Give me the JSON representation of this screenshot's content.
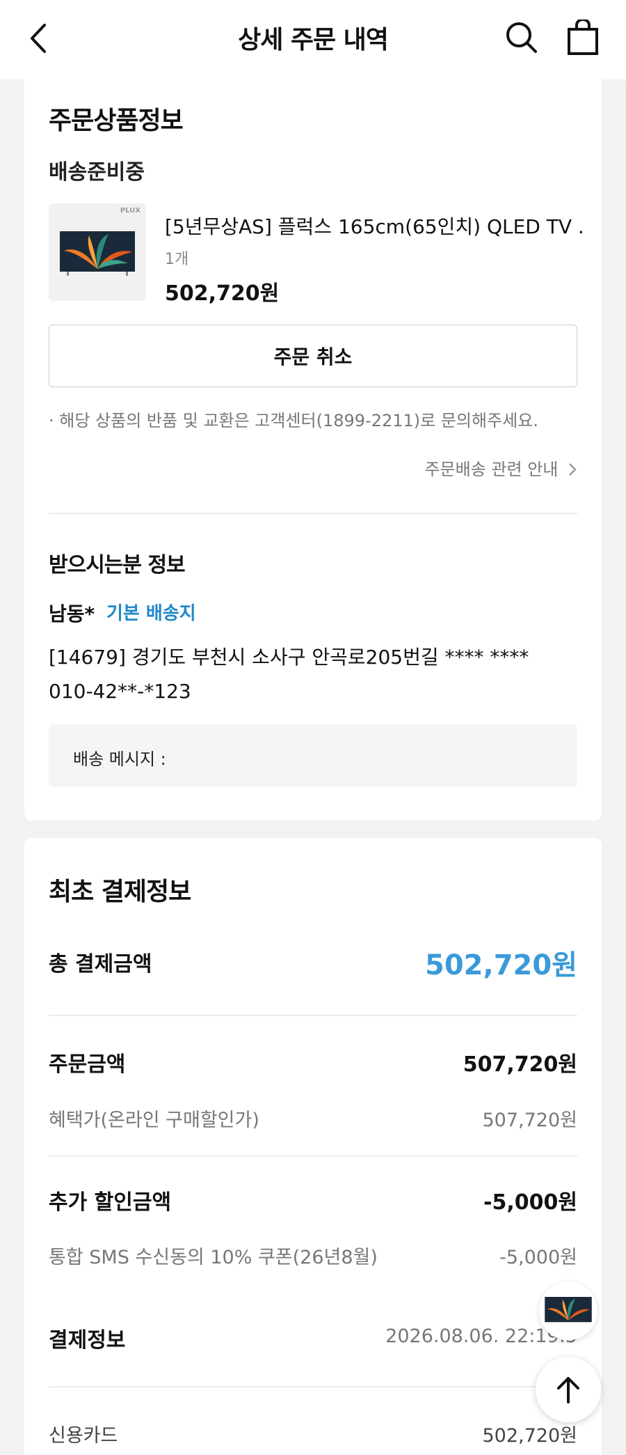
{
  "header": {
    "title": "상세 주문 내역"
  },
  "order_product": {
    "section_title": "주문상품정보",
    "status": "배송준비중",
    "thumb_brand": "PLUX",
    "product_name": "[5년무상AS] 플럭스 165cm(65인치) QLED TV ...",
    "quantity": "1개",
    "price": "502,720원",
    "cancel_label": "주문 취소",
    "notice": "· 해당 상품의 반품 및 교환은 고객센터(1899-2211)로 문의해주세요.",
    "guide_link": "주문배송 관련 안내"
  },
  "recipient": {
    "section_title": "받으시는분 정보",
    "name": "남동*",
    "default_tag": "기본 배송지",
    "address": "[14679] 경기도 부천시 소사구 안곡로205번길 **** ****",
    "phone": "010-42**-*123",
    "message_label": "배송 메시지 :"
  },
  "payment": {
    "section_title": "최초 결제정보",
    "total_label": "총 결제금액",
    "total_value": "502,720원",
    "order_amount_label": "주문금액",
    "order_amount_value": "507,720원",
    "benefit_label": "혜택가(온라인 구매할인가)",
    "benefit_value": "507,720원",
    "extra_discount_label": "추가 할인금액",
    "extra_discount_value": "-5,000원",
    "coupon_label": "통합 SMS 수신동의 10% 쿠폰(26년8월)",
    "coupon_value": "-5,000원",
    "pay_info_label": "결제정보",
    "pay_info_date": "2026.08.06. 22:19:5",
    "card_label": "신용카드",
    "card_value": "502,720원"
  },
  "colors": {
    "accent": "#3a9ad9",
    "tag_blue": "#1f88c9"
  }
}
